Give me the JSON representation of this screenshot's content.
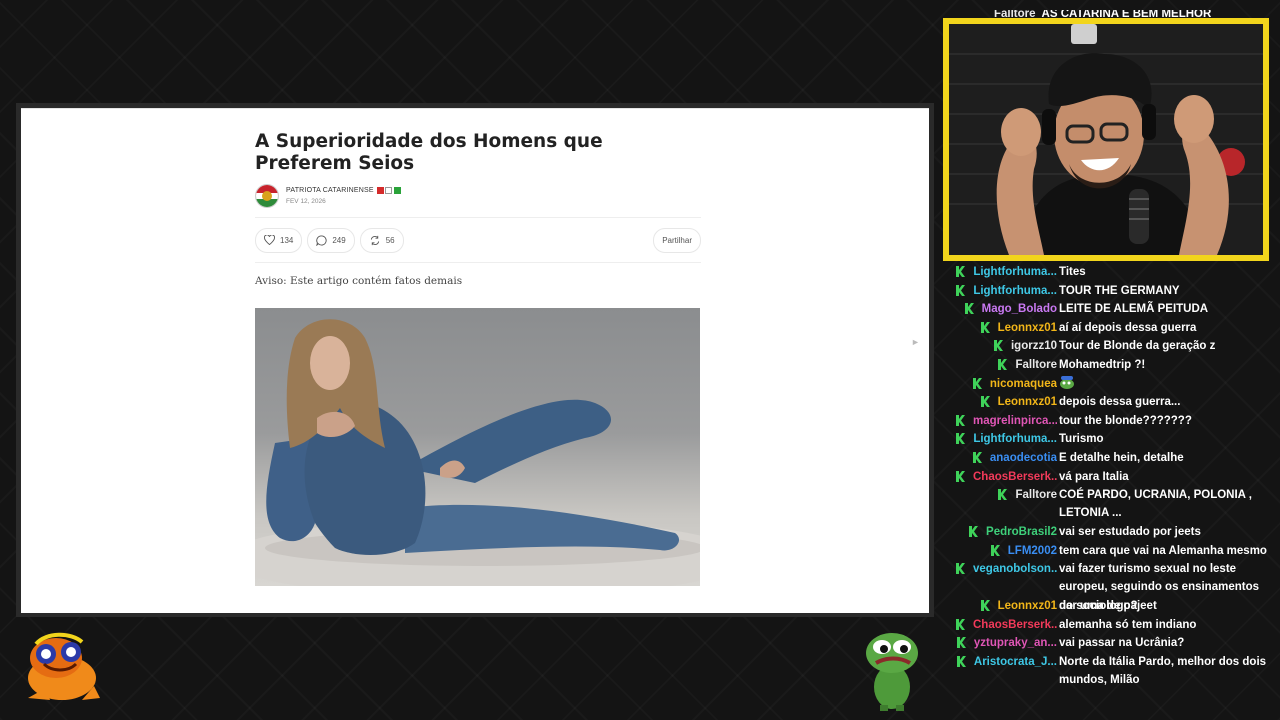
{
  "article": {
    "title": "A Superioridade dos Homens que Preferem Seios",
    "author": "PATRIOTA CATARINENSE",
    "date": "FEV 12, 2026",
    "likes": "134",
    "comments": "249",
    "restacks": "56",
    "share_label": "Partilhar",
    "notice": "Aviso: Este artigo contém fatos demais",
    "flag_colors": [
      "#d42a2a",
      "#ffffff",
      "#2aa33a"
    ]
  },
  "webcam": {
    "pinned_chat_user": "Falltore",
    "pinned_chat_text": "AS CATARINA É BEM MELHOR"
  },
  "chat": {
    "badge_color": "#3fd35a",
    "messages": [
      {
        "user": "Lightforhuma...",
        "text": "Tites",
        "color": "#3ec8e6"
      },
      {
        "user": "Lightforhuma...",
        "text": "TOUR THE GERMANY",
        "color": "#3ec8e6"
      },
      {
        "user": "Mago_Bolado",
        "text": "LEITE DE ALEMÃ PEITUDA",
        "color": "#c979f2"
      },
      {
        "user": "Leonnxz01",
        "text": "aí aí depois dessa guerra",
        "color": "#f2b619"
      },
      {
        "user": "igorzz10",
        "text": "Tour de Blonde da geração z",
        "color": "#e8e8e8"
      },
      {
        "user": "Falltore",
        "text": "Mohamedtrip ?!",
        "color": "#e8e8e8"
      },
      {
        "user": "nicomaquea",
        "text": "",
        "emote": "pepe-hat-emote",
        "color": "#f2b619"
      },
      {
        "user": "Leonnxz01",
        "text": "depois dessa guerra...",
        "color": "#f2b619"
      },
      {
        "user": "magrelinpirca...",
        "text": "tour the blonde???????",
        "color": "#e056b6"
      },
      {
        "user": "Lightforhuma...",
        "text": "Turismo",
        "color": "#3ec8e6"
      },
      {
        "user": "anaodecotia",
        "text": "E detalhe hein, detalhe",
        "color": "#3a8ef2"
      },
      {
        "user": "ChaosBerserk...",
        "text": "vá para Italia",
        "color": "#f23a5a"
      },
      {
        "user": "Falltore",
        "text": "COÉ PARDO, UCRANIA, POLONIA , LETONIA ...",
        "color": "#e8e8e8"
      },
      {
        "user": "PedroBrasil2",
        "text": "vai ser estudado por jeets",
        "color": "#3ed07a"
      },
      {
        "user": "LFM2002",
        "text": "tem cara que vai na Alemanha mesmo",
        "color": "#3a8ef2"
      },
      {
        "user": "veganobolson...",
        "text": "vai fazer turismo sexual no leste europeu, seguindo os ensinamentos do sociologo?",
        "color": "#3ec8e6"
      },
      {
        "user": "Leonnxz01",
        "text": "dar uma de pajeet",
        "color": "#f2b619"
      },
      {
        "user": "ChaosBerserk...",
        "text": "alemanha só tem indiano",
        "color": "#f23a5a"
      },
      {
        "user": "yztupraky_an...",
        "text": "vai passar na Ucrânia?",
        "color": "#e056b6"
      },
      {
        "user": "Aristocrata_J...",
        "text": "Norte da Itália Pardo, melhor dos dois mundos, Milão",
        "color": "#3ec8e6"
      }
    ]
  }
}
